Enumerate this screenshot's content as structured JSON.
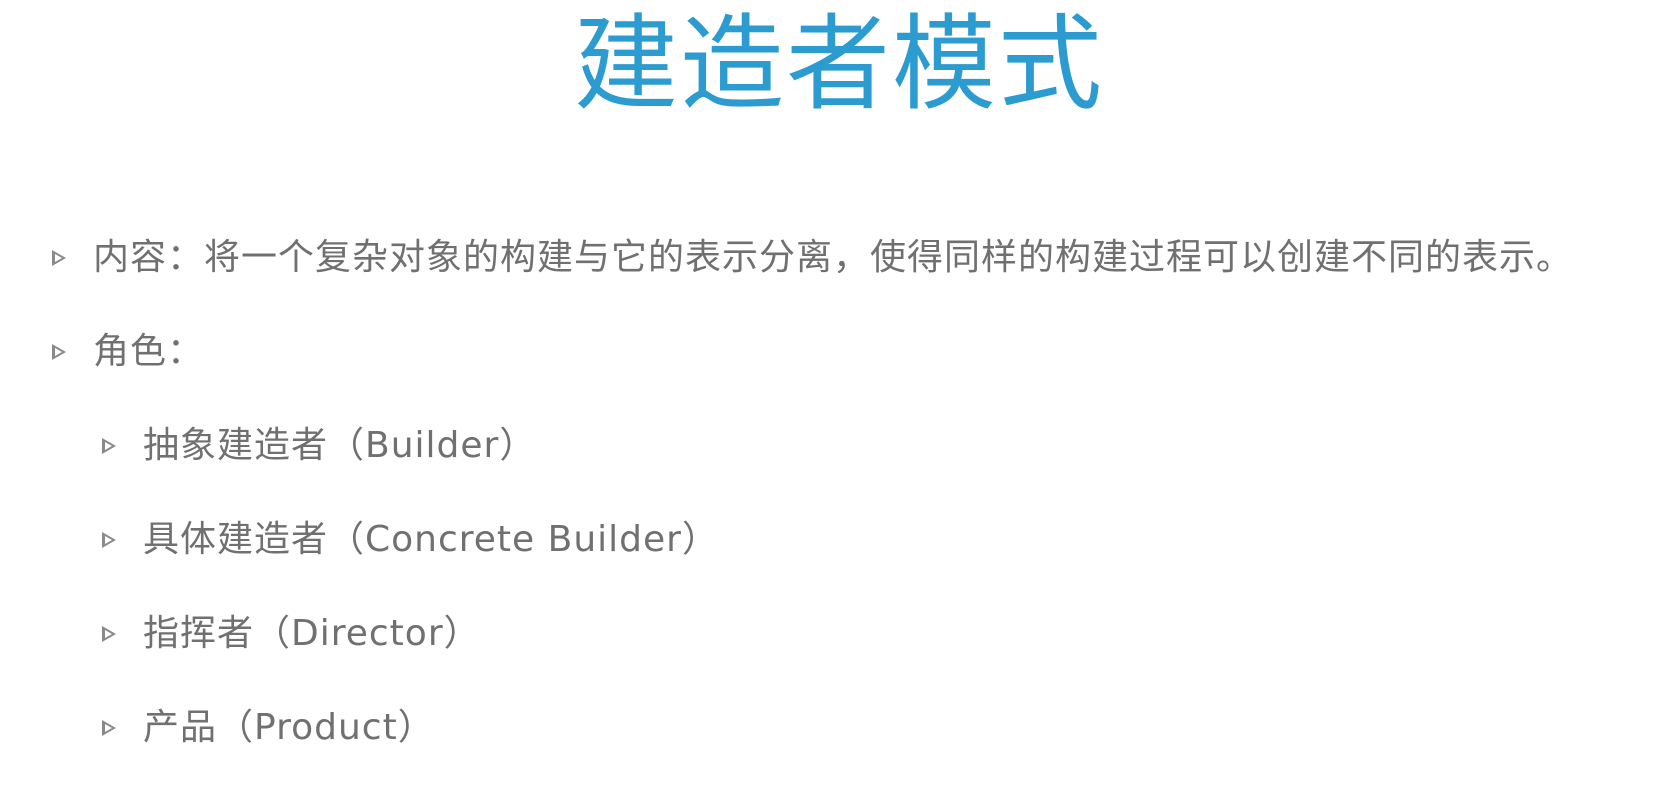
{
  "slide": {
    "title": "建造者模式",
    "title_color": "#2b9bd0",
    "text_color": "#707070",
    "marker_color": "#8a8a8a",
    "bullets": [
      {
        "level": 1,
        "text": "内容：将一个复杂对象的构建与它的表示分离，使得同样的构建过程可以创建不同的表示。"
      },
      {
        "level": 1,
        "text": "角色："
      },
      {
        "level": 2,
        "text": "抽象建造者（Builder）"
      },
      {
        "level": 2,
        "text": "具体建造者（Concrete Builder）"
      },
      {
        "level": 2,
        "text": "指挥者（Director）"
      },
      {
        "level": 2,
        "text": "产品（Product）"
      }
    ]
  }
}
